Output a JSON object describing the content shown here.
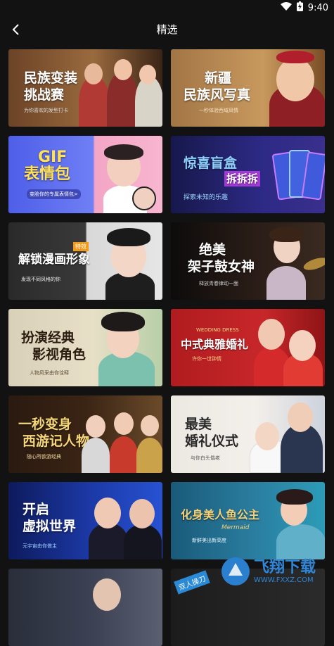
{
  "status": {
    "time": "9:40"
  },
  "header": {
    "title": "精选"
  },
  "cards": [
    {
      "title": "民族变装",
      "title2": "挑战赛",
      "sub": "为你喜欢的发型打卡"
    },
    {
      "title": "新疆",
      "title2": "民族风写真",
      "sub": "一秒体验西域风情"
    },
    {
      "title": "GIF",
      "title2": "表情包",
      "sub": "变脸你的专属表情包>"
    },
    {
      "title": "惊喜盲盒",
      "title2": "拆拆拆",
      "sub": "探索未知的乐趣"
    },
    {
      "title": "解锁漫画形象",
      "title2": "特效",
      "sub": "发现不同风格的你"
    },
    {
      "title": "绝美",
      "title2": "架子鼓女神",
      "sub": "释放青春律动一面"
    },
    {
      "title": "扮演经典",
      "title2": "影视角色",
      "sub": "人物风采由你诠释"
    },
    {
      "title": "中式典雅婚礼",
      "title2": "WEDDING DRESS",
      "sub": "许你一世钟情"
    },
    {
      "title": "一秒变身",
      "title2": "西游记人物",
      "sub": "随心所欲游经典"
    },
    {
      "title": "最美",
      "title2": "婚礼仪式",
      "sub": "与你白头偕老"
    },
    {
      "title": "开启",
      "title2": "虚拟世界",
      "sub": "元宇宙由你做主"
    },
    {
      "title": "化身美人鱼公主",
      "title2": "Mermaid",
      "sub": "新鲜美出新高度"
    },
    {
      "title": "",
      "title2": "",
      "sub": ""
    },
    {
      "title": "双人操刀",
      "title2": "",
      "sub": ""
    }
  ],
  "watermark": {
    "cn": "飞翔下载",
    "url": "WWW.FXXZ.COM"
  }
}
